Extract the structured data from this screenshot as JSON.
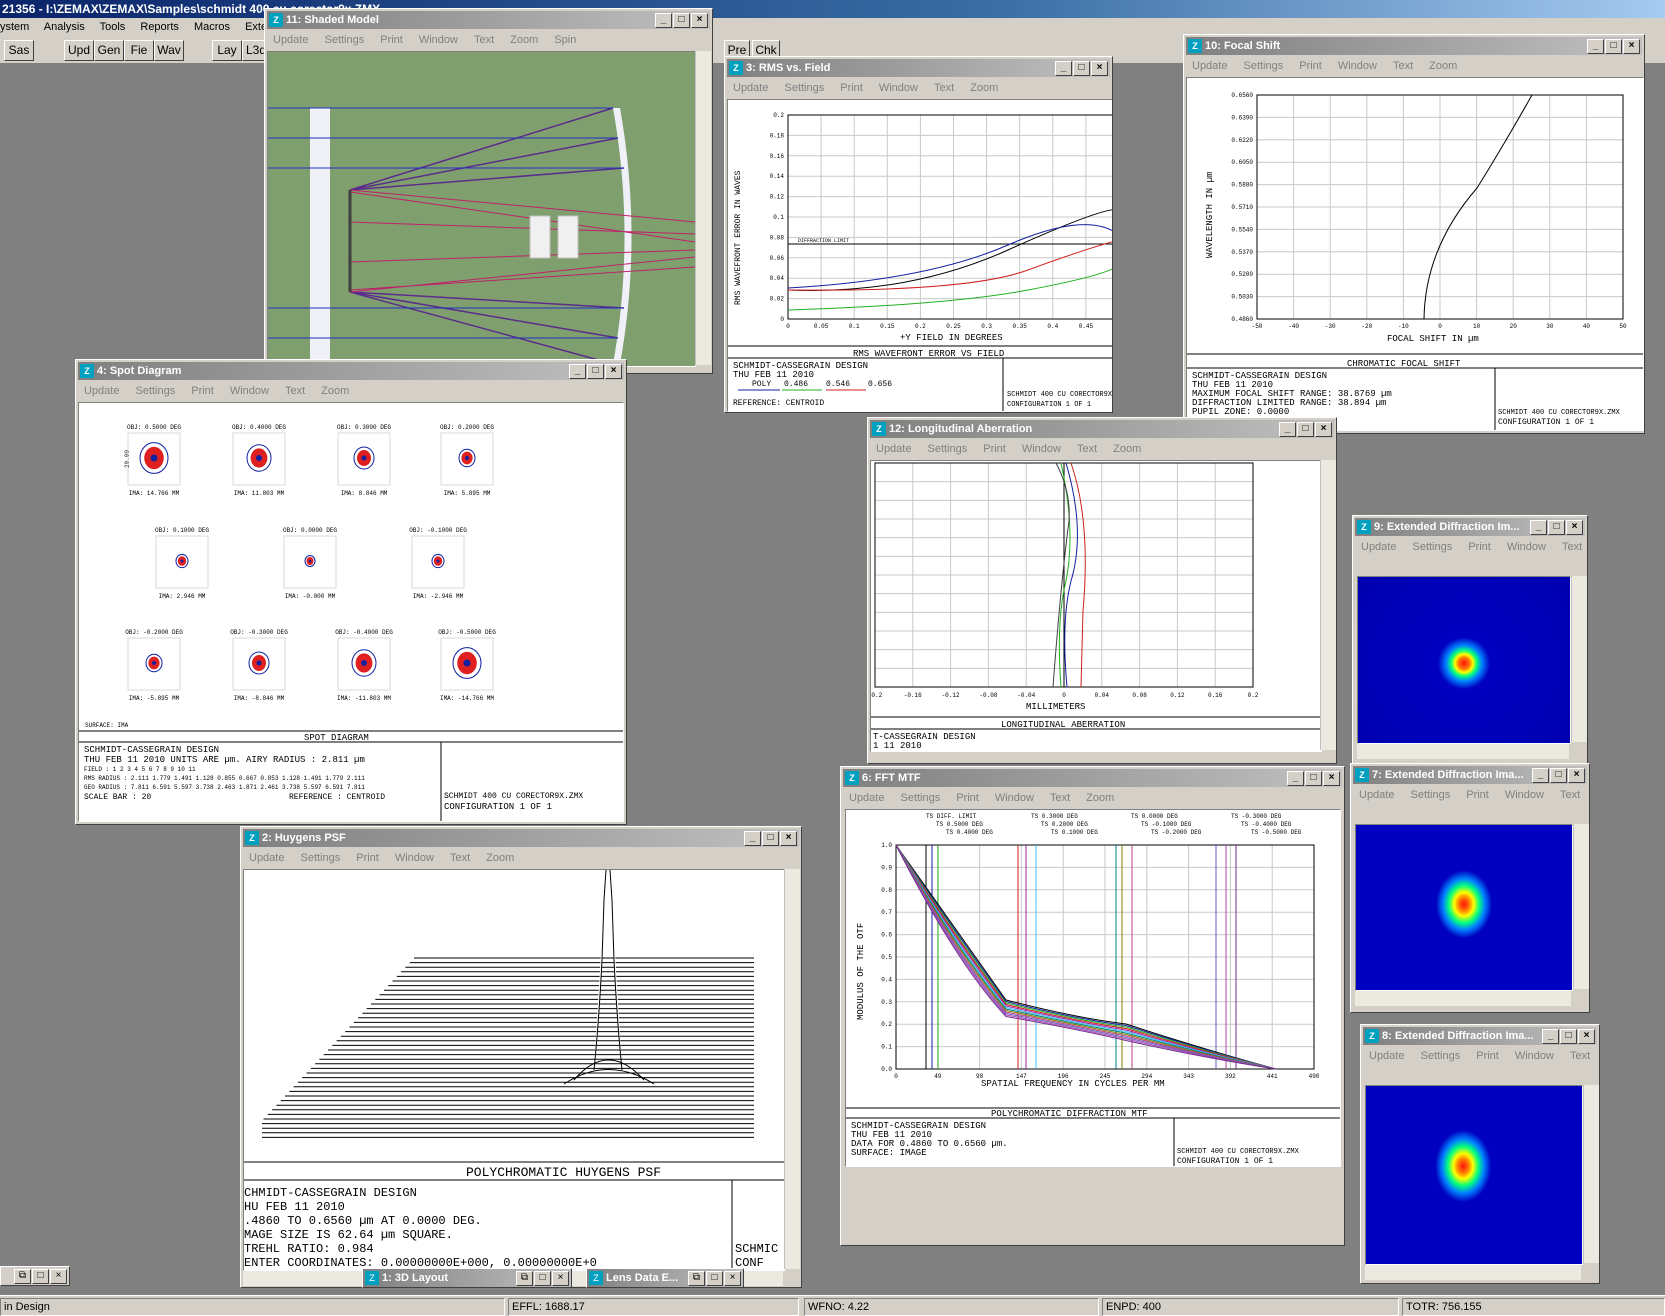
{
  "app": {
    "title": "21356 - I:\\ZEMAX\\ZEMAX\\Samples\\schmidt 400 cu corector9x.ZMX",
    "menu": [
      "ystem",
      "Analysis",
      "Tools",
      "Reports",
      "Macros",
      "Extensio"
    ],
    "toolbar": [
      "Sas",
      "Upd",
      "Gen",
      "Fie",
      "Wav",
      "Lay",
      "L3d",
      "Pre",
      "Chk"
    ],
    "status": {
      "mode": "in Design",
      "effl": "EFFL: 1688.17",
      "wfno": "WFNO: 4.22",
      "enpd": "ENPD: 400",
      "totr": "TOTR: 756.155"
    }
  },
  "window_buttons": {
    "min": "_",
    "max": "□",
    "close": "×",
    "restore": "⧉"
  },
  "win_menu": {
    "update": "Update",
    "settings": "Settings",
    "print": "Print",
    "window": "Window",
    "text": "Text",
    "zoom": "Zoom",
    "spin": "Spin"
  },
  "windows": {
    "shaded": {
      "title": "11: Shaded Model"
    },
    "rms": {
      "title": "3: RMS vs. Field"
    },
    "focal": {
      "title": "10: Focal Shift"
    },
    "spot": {
      "title": "4: Spot Diagram"
    },
    "longab": {
      "title": "12: Longitudinal Aberration"
    },
    "ext9": {
      "title": "9: Extended Diffraction Im..."
    },
    "ext7": {
      "title": "7: Extended Diffraction Ima..."
    },
    "ext8": {
      "title": "8: Extended Diffraction Ima..."
    },
    "mtf": {
      "title": "6: FFT MTF"
    },
    "psf": {
      "title": "2: Huygens PSF"
    },
    "layout3d": {
      "title": "1: 3D Layout"
    },
    "lensdata": {
      "title": "Lens Data E..."
    }
  },
  "rms_plot": {
    "ylabel": "RMS WAVEFRONT ERROR IN WAVES",
    "xlabel": "+Y FIELD IN DEGREES",
    "yticks": [
      "0.2",
      "0.18",
      "0.16",
      "0.14",
      "0.12",
      "0.1",
      "0.08",
      "0.06",
      "0.04",
      "0.02",
      "0"
    ],
    "xticks": [
      "0",
      "0.05",
      "0.1",
      "0.15",
      "0.2",
      "0.25",
      "0.3",
      "0.35",
      "0.4",
      "0.45",
      "0.5"
    ],
    "limit_label": "DIFFRACTION LIMIT",
    "caption": "RMS WAVEFRONT ERROR VS FIELD",
    "info1": "SCHMIDT-CASSEGRAIN DESIGN",
    "info2": "THU FEB 11 2010",
    "poly_label": "POLY",
    "w1": "0.486",
    "w2": "0.546",
    "w3": "0.656",
    "reference": "REFERENCE: CENTROID",
    "file": "SCHMIDT 400 CU CORECTOR9X.ZMX",
    "config": "CONFIGURATION 1 OF 1"
  },
  "focal_plot": {
    "ylabel": "WAVELENGTH IN µm",
    "xlabel": "FOCAL SHIFT IN µm",
    "yticks": [
      "0.6560",
      "0.6390",
      "0.6220",
      "0.6050",
      "0.5880",
      "0.5710",
      "0.5540",
      "0.5370",
      "0.5200",
      "0.5030",
      "0.4860"
    ],
    "xticks": [
      "-50",
      "-40",
      "-30",
      "-20",
      "-10",
      "0",
      "10",
      "20",
      "30",
      "40",
      "50"
    ],
    "caption": "CHROMATIC FOCAL SHIFT",
    "info1": "SCHMIDT-CASSEGRAIN DESIGN",
    "info2": "THU FEB 11 2010",
    "info3": "MAXIMUM FOCAL SHIFT RANGE: 38.8769 µm",
    "info4": "DIFFRACTION LIMITED RANGE: 38.894 µm",
    "info5": "PUPIL ZONE: 0.0000",
    "file": "SCHMIDT 400 CU CORECTOR9X.ZMX",
    "config": "CONFIGURATION 1 OF 1"
  },
  "spot": {
    "spots": [
      {
        "obj": "OBJ: 0.5000 DEG",
        "ima": "IMA: 14.766 MM"
      },
      {
        "obj": "OBJ: 0.4000 DEG",
        "ima": "IMA: 11.803 MM"
      },
      {
        "obj": "OBJ: 0.3000 DEG",
        "ima": "IMA: 8.846 MM"
      },
      {
        "obj": "OBJ: 0.2000 DEG",
        "ima": "IMA: 5.895 MM"
      },
      {
        "obj": "OBJ: 0.1000 DEG",
        "ima": "IMA: 2.946 MM"
      },
      {
        "obj": "OBJ: 0.0000 DEG",
        "ima": "IMA: -0.000 MM"
      },
      {
        "obj": "OBJ: -0.1000 DEG",
        "ima": "IMA: -2.946 MM"
      },
      {
        "obj": "OBJ: -0.2000 DEG",
        "ima": "IMA: -5.895 MM"
      },
      {
        "obj": "OBJ: -0.3000 DEG",
        "ima": "IMA: -8.846 MM"
      },
      {
        "obj": "OBJ: -0.4000 DEG",
        "ima": "IMA: -11.803 MM"
      },
      {
        "obj": "OBJ: -0.5000 DEG",
        "ima": "IMA: -14.766 MM"
      }
    ],
    "scale": "20.00",
    "surface": "SURFACE: IMA",
    "caption": "SPOT DIAGRAM",
    "info1": "SCHMIDT-CASSEGRAIN DESIGN",
    "info2": "THU FEB 11 2010  UNITS ARE µm.  AIRY RADIUS : 2.811 µm",
    "field_hdr": "FIELD :  1     2     3     4     5     6     7     8     9    10    11",
    "rms_row": "RMS RADIUS :  2.111  1.779  1.491  1.128  0.855  0.667  0.853  1.128  1.491  1.779  2.111",
    "geo_row": "GEO RADIUS :  7.811  6.591  5.597  3.738  2.463  1.871  2.461  3.738  5.597  6.591  7.811",
    "scale_bar": "SCALE BAR  :       20",
    "reference": "REFERENCE  : CENTROID",
    "file": "SCHMIDT 400 CU CORECTOR9X.ZMX",
    "config": "CONFIGURATION 1 OF 1"
  },
  "longab": {
    "xticks": [
      "-0.2",
      "-0.16",
      "-0.12",
      "-0.08",
      "-0.04",
      "0",
      "0.04",
      "0.08",
      "0.12",
      "0.16",
      "0.2"
    ],
    "xlabel": "MILLIMETERS",
    "caption": "LONGITUDINAL ABERRATION",
    "info1": "T-CASSEGRAIN DESIGN",
    "info2": "1 11 2010"
  },
  "mtf": {
    "legend": [
      [
        "TS DIFF. LIMIT",
        "TS 0.5000 DEG",
        "TS 0.4000 DEG"
      ],
      [
        "TS 0.3000 DEG",
        "TS 0.2000 DEG",
        "TS 0.1000 DEG"
      ],
      [
        "TS 0.0000 DEG",
        "TS -0.1000 DEG",
        "TS -0.2000 DEG"
      ],
      [
        "TS -0.3000 DEG",
        "TS -0.4000 DEG",
        "TS -0.5000 DEG"
      ]
    ],
    "ylabel": "MODULUS OF THE OTF",
    "xlabel": "SPATIAL FREQUENCY IN CYCLES PER MM",
    "yticks": [
      "1.0",
      "0.9",
      "0.8",
      "0.7",
      "0.6",
      "0.5",
      "0.4",
      "0.3",
      "0.2",
      "0.1",
      "0.0"
    ],
    "xticks": [
      "0",
      "49",
      "98",
      "147",
      "196",
      "245",
      "294",
      "343",
      "392",
      "441",
      "490"
    ],
    "caption": "POLYCHROMATIC DIFFRACTION MTF",
    "info1": "SCHMIDT-CASSEGRAIN DESIGN",
    "info2": "THU FEB 11 2010",
    "info3": "DATA FOR 0.4860 TO 0.6560 µm.",
    "info4": "SURFACE: IMAGE",
    "file": "SCHMIDT 400 CU CORECTOR9X.ZMX",
    "config": "CONFIGURATION 1 OF 1"
  },
  "psf": {
    "caption": "POLYCHROMATIC HUYGENS PSF",
    "l1": "CHMIDT-CASSEGRAIN DESIGN",
    "l2": "HU FEB 11 2010",
    "l3": ".4860 TO 0.6560 µm AT 0.0000 DEG.",
    "l4": "MAGE SIZE IS 62.64 µm SQUARE.",
    "l5": "TREHL RATIO: 0.984",
    "l6": "ENTER COORDINATES: 0.00000000E+000, 0.00000000E+0",
    "file": "SCHMIC",
    "config": "CONF"
  }
}
